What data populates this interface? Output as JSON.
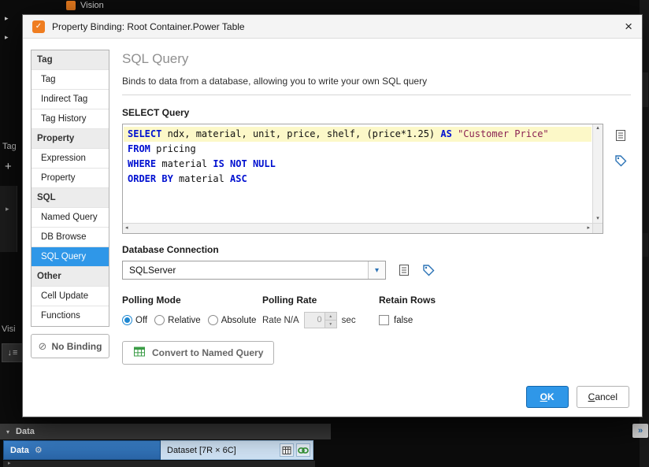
{
  "background": {
    "app_tab_label": "Vision",
    "left_tag_label": "Tag",
    "left_plus": "+",
    "left_tab_partial": "Visi",
    "data_panel": {
      "header_label": "Data",
      "row_label": "Data",
      "row_value": "Dataset [7R × 6C]"
    }
  },
  "icons": {
    "logo_glyph": "✓",
    "close": "×",
    "no_binding": "⊘",
    "dropdown_arrow": "▾",
    "spinner_up": "▲",
    "spinner_down": "▼",
    "scroll_left": "◂",
    "scroll_right": "▸",
    "scroll_up": "▴",
    "scroll_down": "▾",
    "collapse_triangle": "▾",
    "expand_triangle": "▸",
    "wrench": "⚙",
    "sort_arrow": "↓",
    "sort_lines": "≡",
    "chevrons": "»"
  },
  "dialog": {
    "title": "Property Binding: Root Container.Power Table",
    "sidebar": {
      "sections": [
        {
          "header": "Tag",
          "items": [
            "Tag",
            "Indirect Tag",
            "Tag History"
          ]
        },
        {
          "header": "Property",
          "items": [
            "Expression",
            "Property"
          ]
        },
        {
          "header": "SQL",
          "items": [
            "Named Query",
            "DB Browse",
            "SQL Query"
          ]
        },
        {
          "header": "Other",
          "items": [
            "Cell Update",
            "Functions"
          ]
        }
      ],
      "selected_item": "SQL Query",
      "no_binding_label": "No Binding"
    },
    "content": {
      "title": "SQL Query",
      "subtitle": "Binds to data from a database, allowing you to write your own SQL query",
      "select_query_label": "SELECT Query",
      "sql_lines": [
        {
          "tokens": [
            {
              "t": "SELECT",
              "c": "kw"
            },
            {
              "t": " ndx, material, unit, price, shelf, (price*1.25) ",
              "c": "p"
            },
            {
              "t": "AS",
              "c": "kw"
            },
            {
              "t": " ",
              "c": "p"
            },
            {
              "t": "\"Customer Price\"",
              "c": "str"
            }
          ]
        },
        {
          "tokens": [
            {
              "t": "FROM",
              "c": "kw"
            },
            {
              "t": " pricing",
              "c": "p"
            }
          ]
        },
        {
          "tokens": [
            {
              "t": "WHERE",
              "c": "kw"
            },
            {
              "t": " material ",
              "c": "p"
            },
            {
              "t": "IS NOT NULL",
              "c": "kw"
            }
          ]
        },
        {
          "tokens": [
            {
              "t": "ORDER BY",
              "c": "kw"
            },
            {
              "t": " material ",
              "c": "p"
            },
            {
              "t": "ASC",
              "c": "kw"
            }
          ]
        }
      ],
      "database_connection_label": "Database Connection",
      "database_connection_value": "SQLServer",
      "polling_mode_label": "Polling Mode",
      "polling_options": [
        "Off",
        "Relative",
        "Absolute"
      ],
      "polling_selected": "Off",
      "polling_rate_label": "Polling Rate",
      "rate_text": "Rate N/A",
      "rate_value": "0",
      "rate_unit": "sec",
      "retain_rows_label": "Retain Rows",
      "retain_rows_checkbox_label": "false",
      "convert_button_label": "Convert to Named Query",
      "ok_label": "OK",
      "cancel_label": "Cancel"
    }
  }
}
